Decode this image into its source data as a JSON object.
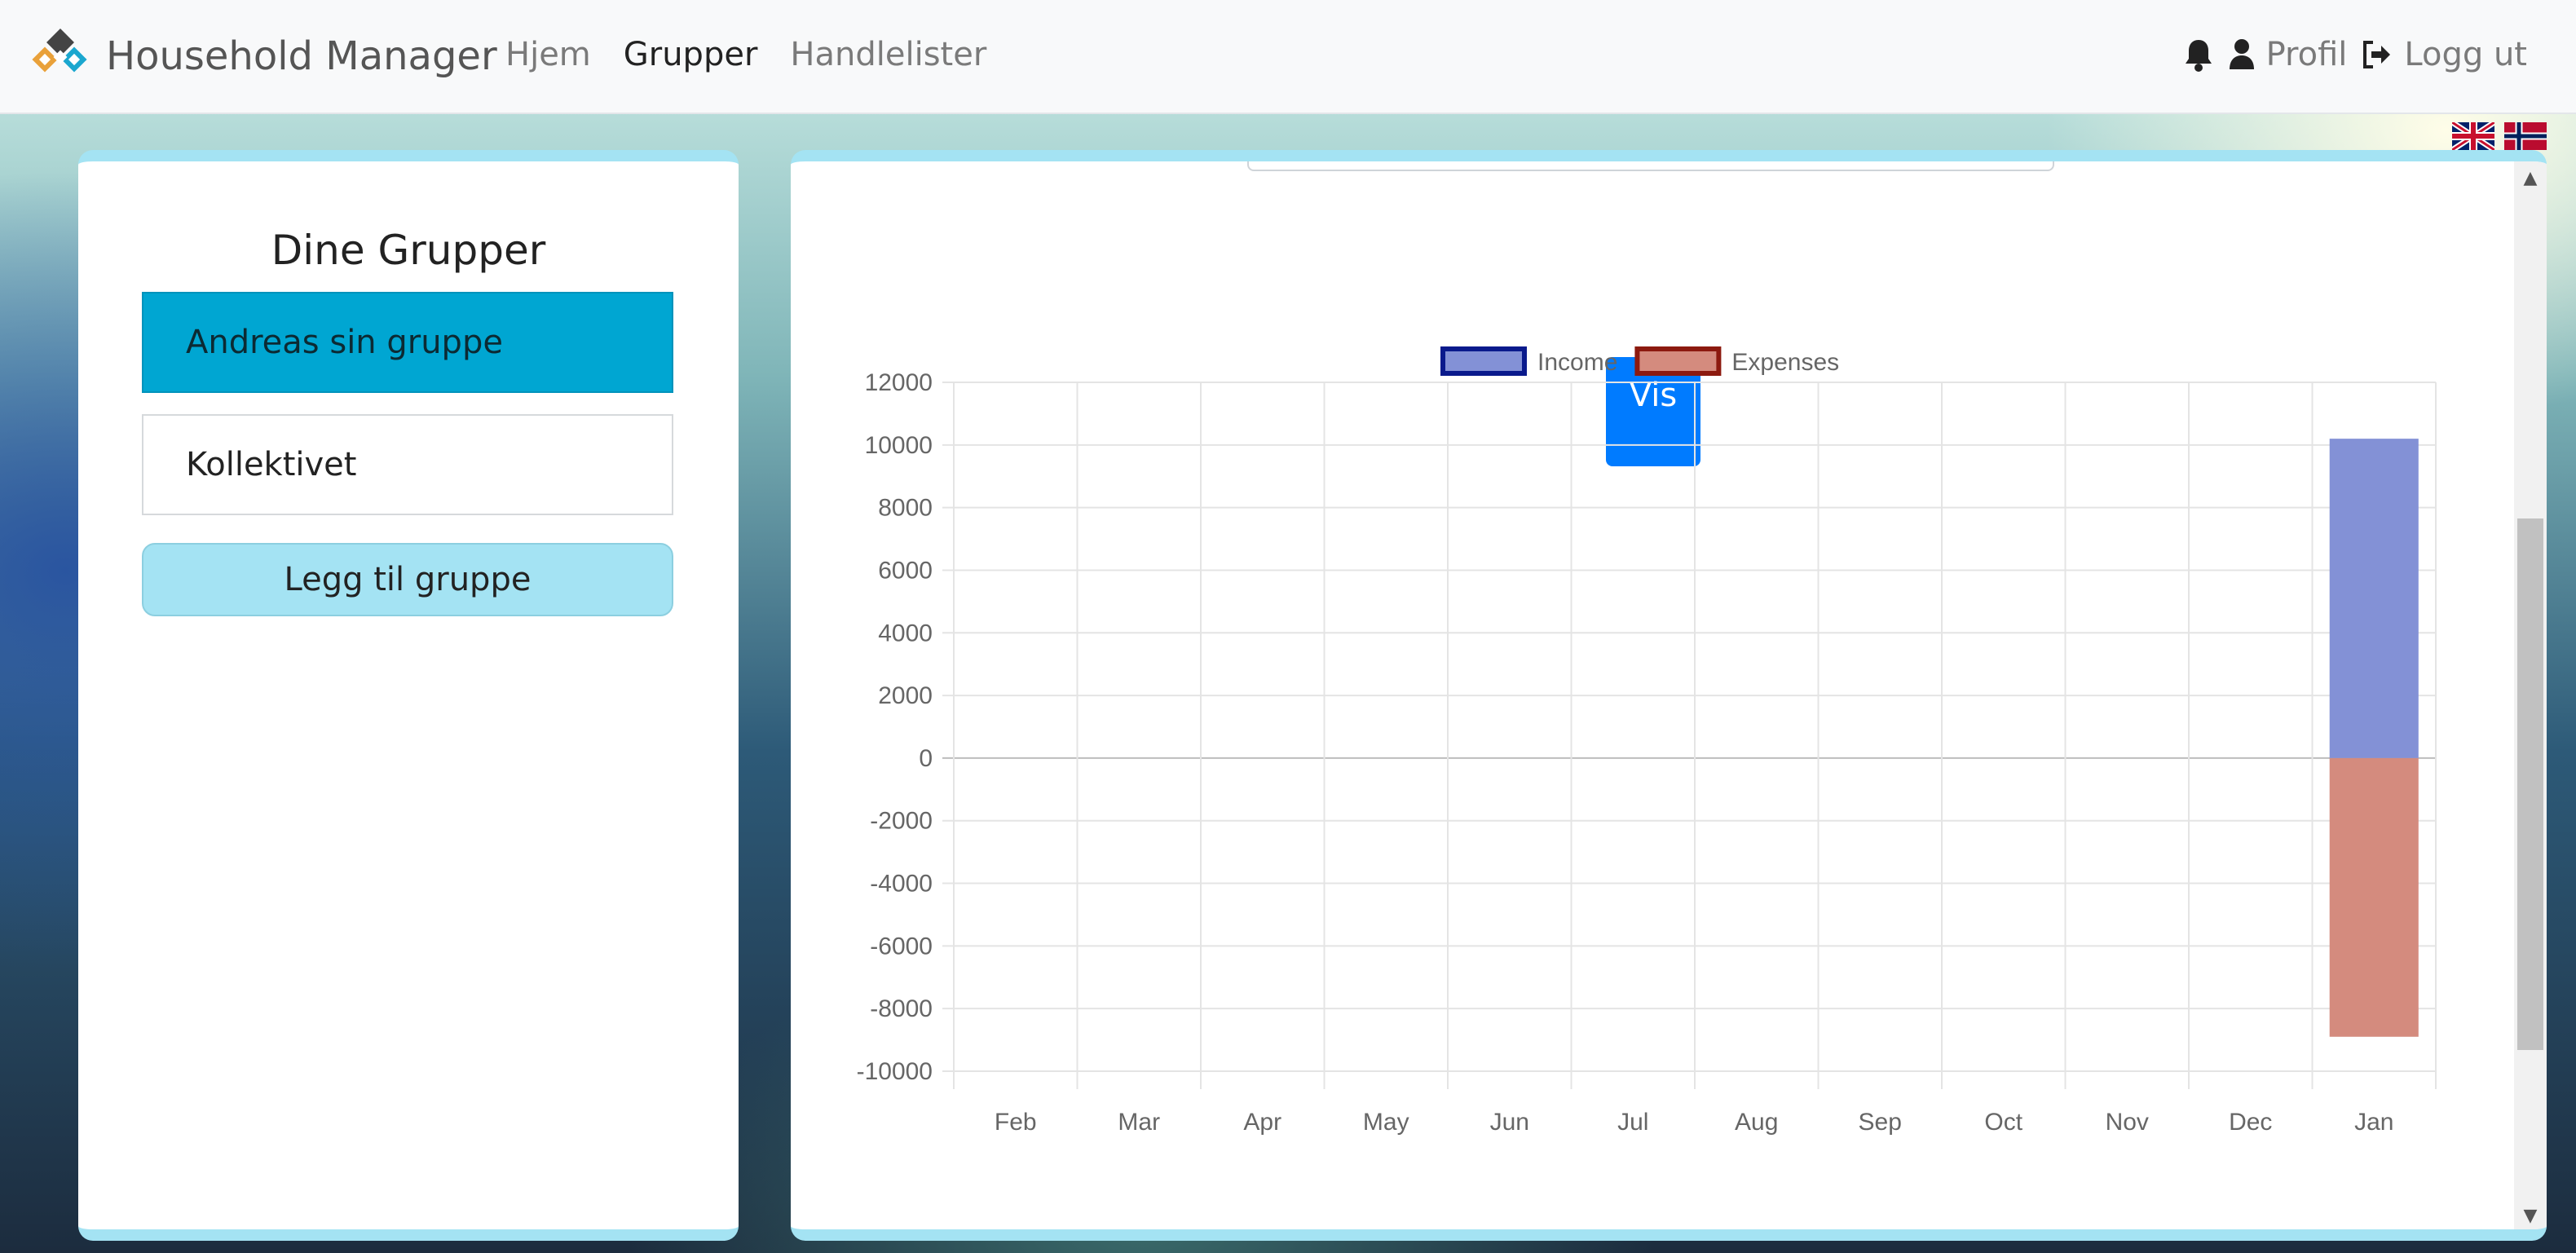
{
  "navbar": {
    "brand": "Household Manager",
    "links": [
      {
        "label": "Hjem",
        "active": false
      },
      {
        "label": "Grupper",
        "active": true
      },
      {
        "label": "Handlelister",
        "active": false
      }
    ],
    "profile_label": "Profil",
    "logout_label": "Logg ut"
  },
  "languages": [
    "English",
    "Norsk"
  ],
  "groups_panel": {
    "title": "Dine Grupper",
    "groups": [
      {
        "name": "Andreas sin gruppe",
        "selected": true
      },
      {
        "name": "Kollektivet",
        "selected": false
      }
    ],
    "add_label": "Legg til gruppe"
  },
  "chart_panel": {
    "show_button": "Vis"
  },
  "chart_data": {
    "type": "bar",
    "categories": [
      "Feb",
      "Mar",
      "Apr",
      "May",
      "Jun",
      "Jul",
      "Aug",
      "Sep",
      "Oct",
      "Nov",
      "Dec",
      "Jan"
    ],
    "series": [
      {
        "name": "Income",
        "values": [
          0,
          0,
          0,
          0,
          0,
          0,
          0,
          0,
          0,
          0,
          0,
          10200
        ],
        "color": "#8391d6",
        "border": "#0a1a8c"
      },
      {
        "name": "Expenses",
        "values": [
          0,
          0,
          0,
          0,
          0,
          0,
          0,
          0,
          0,
          0,
          0,
          -8900
        ],
        "color": "#d48b7e",
        "border": "#8c1a0f"
      }
    ],
    "stacked": true,
    "ylim": [
      -10000,
      12000
    ],
    "yticks": [
      12000,
      10000,
      8000,
      6000,
      4000,
      2000,
      0,
      -2000,
      -4000,
      -6000,
      -8000,
      -10000
    ],
    "grid": true,
    "legend": "top-center"
  }
}
